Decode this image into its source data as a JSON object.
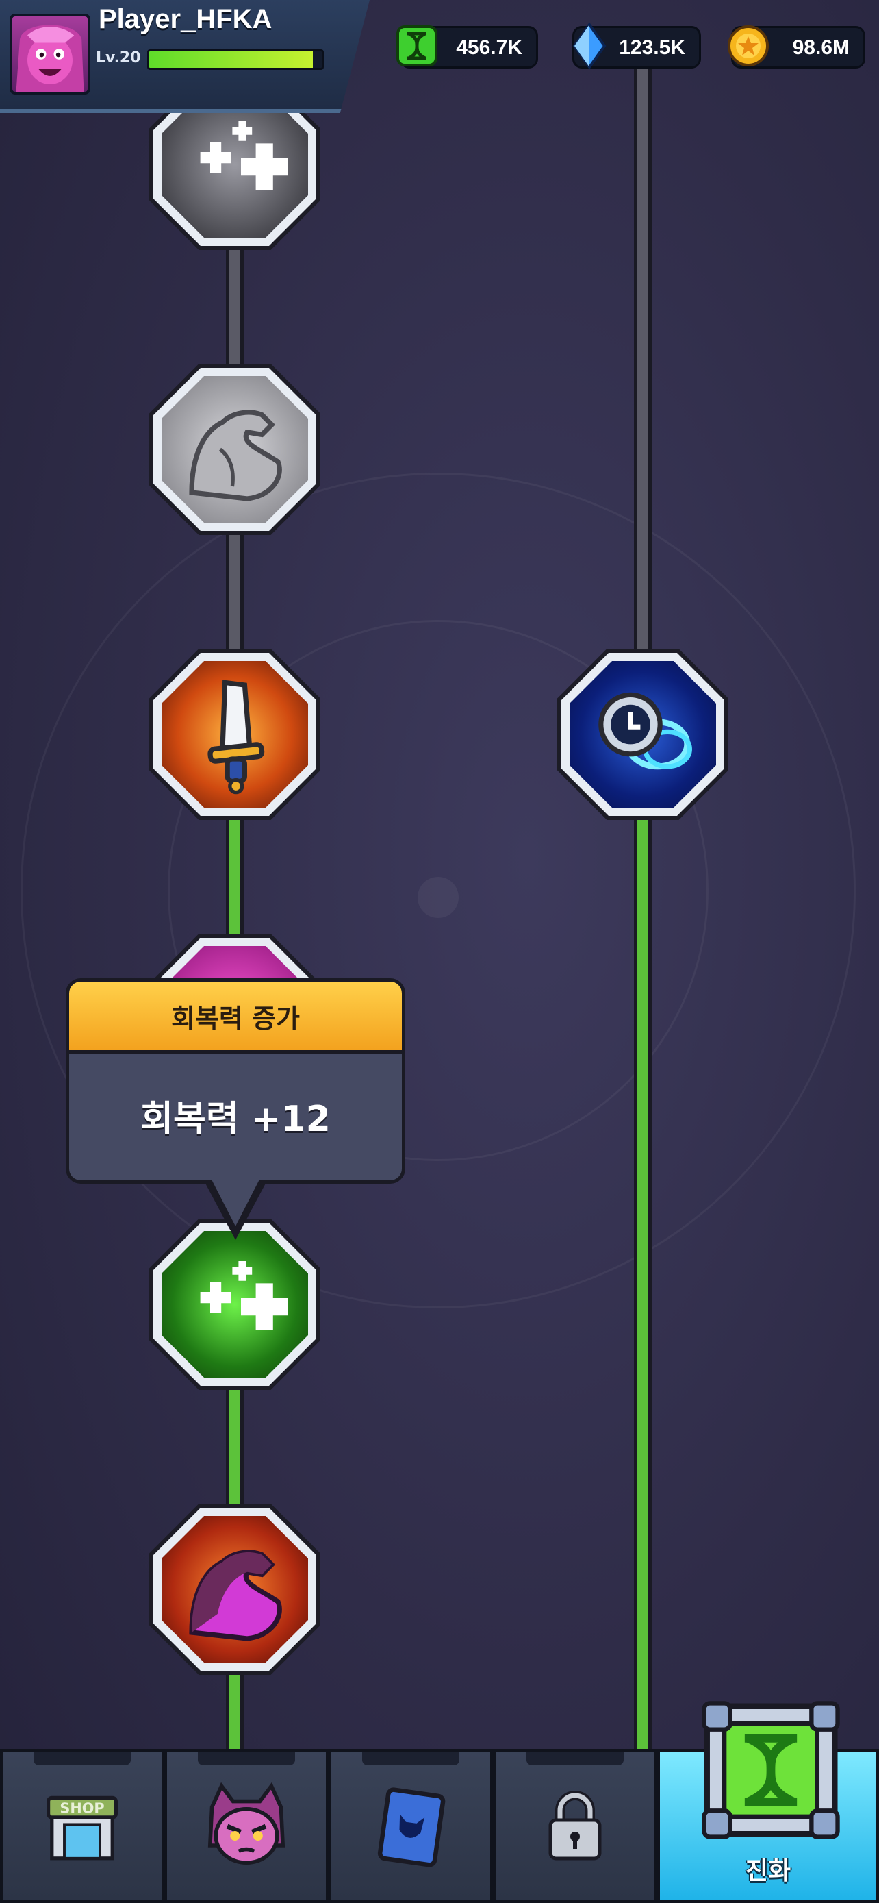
{
  "player": {
    "name": "Player_HFKA",
    "level_label": "Lv.20",
    "xp_fraction": 0.95
  },
  "currencies": [
    {
      "name": "dna",
      "value": "456.7K",
      "icon": "dna-icon",
      "color": "#3ecf2f"
    },
    {
      "name": "gem",
      "value": "123.5K",
      "icon": "diamond-icon",
      "color": "#3b9cff"
    },
    {
      "name": "gold",
      "value": "98.6M",
      "icon": "coin-icon",
      "color": "#f6b51c"
    }
  ],
  "skill_tree": {
    "left_column": [
      {
        "icon": "heal-plus-icon",
        "state": "locked"
      },
      {
        "icon": "muscle-arm-icon",
        "state": "locked"
      },
      {
        "icon": "sword-icon",
        "state": "unlocked"
      },
      {
        "icon": "magenta-node-icon",
        "state": "unlocked"
      },
      {
        "icon": "heal-plus-icon",
        "state": "unlocked"
      },
      {
        "icon": "muscle-arm-icon",
        "state": "unlocked"
      }
    ],
    "right_column": [
      {
        "icon": "clock-speed-icon",
        "state": "unlocked"
      }
    ]
  },
  "tooltip": {
    "title": "회복력 증가",
    "description": "회복력 +12"
  },
  "bottom_nav": {
    "tabs": [
      {
        "name": "shop",
        "icon": "shop-icon",
        "label": ""
      },
      {
        "name": "hero",
        "icon": "character-icon",
        "label": ""
      },
      {
        "name": "monster-card",
        "icon": "monster-card-icon",
        "label": ""
      },
      {
        "name": "locked",
        "icon": "lock-icon",
        "label": ""
      },
      {
        "name": "evolution",
        "icon": "dna-icon",
        "label": "진화",
        "active": true
      }
    ],
    "shop_sign": "SHOP"
  },
  "colors": {
    "accent_green": "#5cc23a",
    "tooltip_header": "#ffc53a",
    "active_tab": "#29b8ea"
  }
}
